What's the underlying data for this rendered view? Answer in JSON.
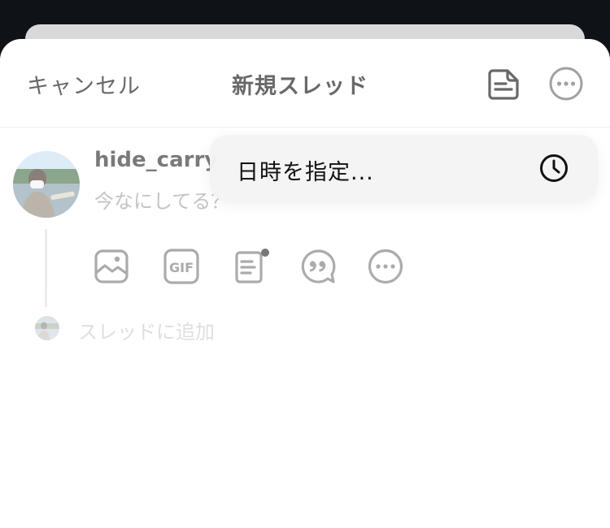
{
  "header": {
    "cancel_label": "キャンセル",
    "title": "新規スレッド",
    "draft_icon": "draft-document-icon",
    "more_icon": "more-horizontal-icon"
  },
  "composer": {
    "username": "hide_carry",
    "placeholder": "今なにしてる？",
    "tools": [
      {
        "name": "image-icon"
      },
      {
        "name": "gif-icon",
        "label": "GIF"
      },
      {
        "name": "drafts-icon"
      },
      {
        "name": "quote-icon"
      },
      {
        "name": "more-icon"
      }
    ],
    "add_thread_label": "スレッドに追加"
  },
  "menu": {
    "schedule_label": "日時を指定...",
    "schedule_icon": "clock-icon"
  },
  "colors": {
    "background": "#0f1216",
    "sheet": "#ffffff",
    "menu": "#f4f4f5",
    "icon_gray": "#6b6b6b",
    "placeholder_gray": "#9a9a9a"
  }
}
